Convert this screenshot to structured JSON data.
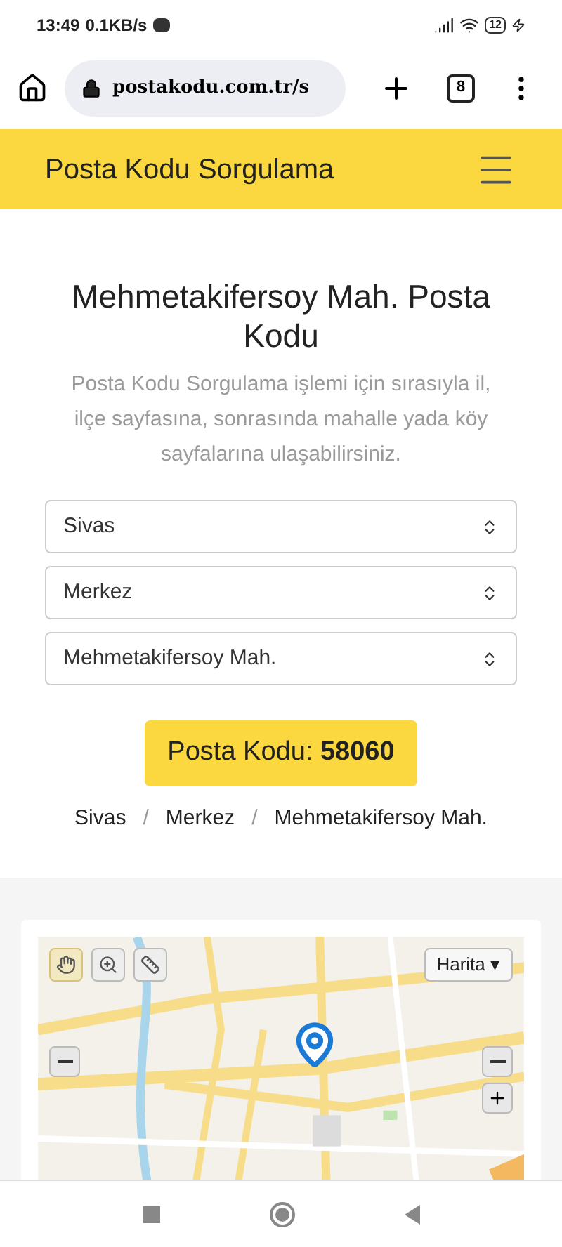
{
  "status_bar": {
    "time": "13:49",
    "speed": "0.1KB/s",
    "battery": "12"
  },
  "browser": {
    "url": "postakodu.com.tr/s",
    "tab_count": "8"
  },
  "header": {
    "title": "Posta Kodu Sorgulama"
  },
  "main": {
    "title": "Mehmetakifersoy Mah. Posta Kodu",
    "description": "Posta Kodu Sorgulama işlemi için sırasıyla il, ilçe sayfasına, sonrasında mahalle yada köy sayfalarına ulaşabilirsiniz.",
    "selects": [
      {
        "value": "Sivas"
      },
      {
        "value": "Merkez"
      },
      {
        "value": "Mehmetakifersoy Mah."
      }
    ],
    "result": {
      "label": "Posta Kodu:",
      "code": "58060"
    },
    "breadcrumb": [
      {
        "label": "Sivas"
      },
      {
        "separator": "/",
        "label": "Merkez"
      },
      {
        "separator": "/",
        "label": "Mehmetakifersoy Mah."
      }
    ]
  },
  "map": {
    "type_button": "Harita ▾",
    "tools": [
      {
        "kind": "pan",
        "selected": true
      },
      {
        "kind": "zoom",
        "selected": false
      },
      {
        "kind": "measure",
        "selected": false
      }
    ]
  }
}
